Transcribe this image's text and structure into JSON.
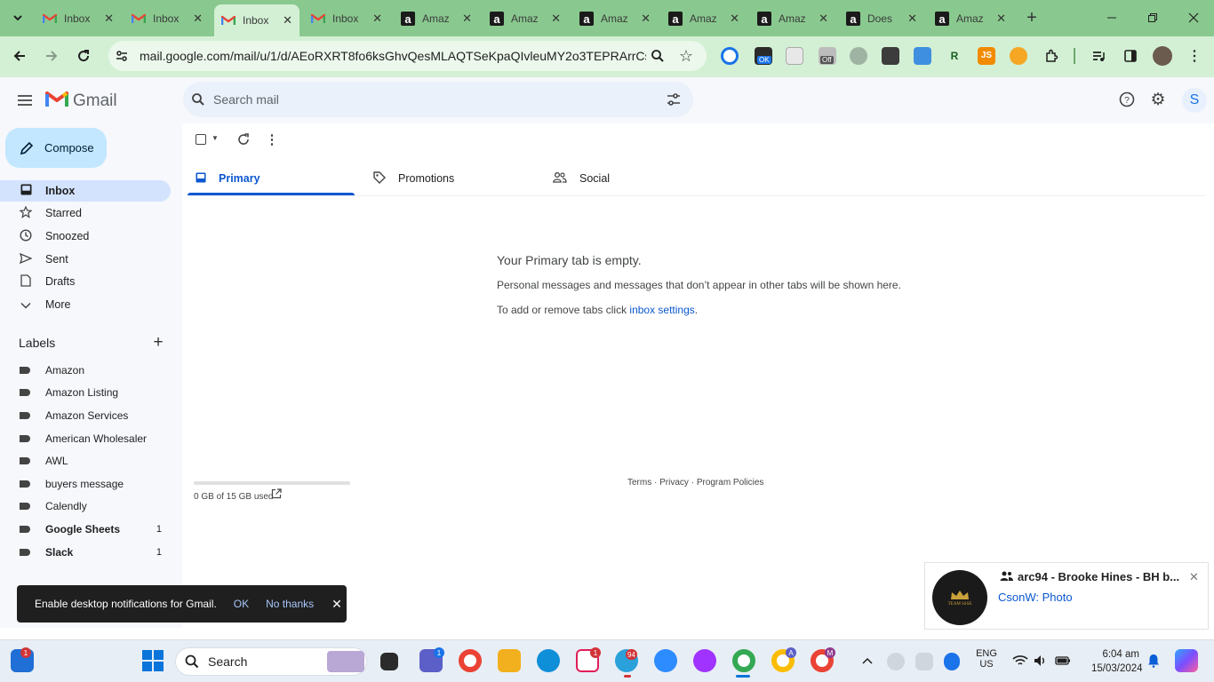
{
  "browser": {
    "tabs": [
      {
        "title": "Inbox",
        "favicon": "gmail-icon",
        "active": false
      },
      {
        "title": "Inbox",
        "favicon": "gmail-icon",
        "active": false
      },
      {
        "title": "Inbox",
        "favicon": "gmail-icon",
        "active": true
      },
      {
        "title": "Inbox",
        "favicon": "gmail-icon",
        "active": false
      },
      {
        "title": "Amaz",
        "favicon": "amazon-icon",
        "active": false
      },
      {
        "title": "Amaz",
        "favicon": "amazon-icon",
        "active": false
      },
      {
        "title": "Amaz",
        "favicon": "amazon-icon",
        "active": false
      },
      {
        "title": "Amaz",
        "favicon": "amazon-icon",
        "active": false
      },
      {
        "title": "Amaz",
        "favicon": "amazon-icon",
        "active": false
      },
      {
        "title": "Does",
        "favicon": "amazon-icon",
        "active": false
      },
      {
        "title": "Amaz",
        "favicon": "amazon-icon",
        "active": false
      }
    ],
    "url": "mail.google.com/mail/u/1/d/AEoRXRT8fo6ksGhvQesMLAQTSeKpaQIvleuMY2o3TEPRArrCs...",
    "theme_color": "#89c98f",
    "toolbar_color": "#d3f0d4"
  },
  "gmail": {
    "logo_text": "Gmail",
    "search_placeholder": "Search mail",
    "avatar_letter": "S",
    "compose_label": "Compose",
    "nav": [
      {
        "label": "Inbox",
        "icon": "inbox-icon",
        "active": true
      },
      {
        "label": "Starred",
        "icon": "star-icon",
        "active": false
      },
      {
        "label": "Snoozed",
        "icon": "clock-icon",
        "active": false
      },
      {
        "label": "Sent",
        "icon": "send-icon",
        "active": false
      },
      {
        "label": "Drafts",
        "icon": "draft-icon",
        "active": false
      },
      {
        "label": "More",
        "icon": "chevron-down-icon",
        "active": false
      }
    ],
    "labels_heading": "Labels",
    "labels": [
      {
        "name": "Amazon",
        "count": "",
        "bold": false
      },
      {
        "name": "Amazon Listing",
        "count": "",
        "bold": false
      },
      {
        "name": "Amazon Services",
        "count": "",
        "bold": false
      },
      {
        "name": "American Wholesaler",
        "count": "",
        "bold": false
      },
      {
        "name": "AWL",
        "count": "",
        "bold": false
      },
      {
        "name": "buyers message",
        "count": "",
        "bold": false
      },
      {
        "name": "Calendly",
        "count": "",
        "bold": false
      },
      {
        "name": "Google Sheets",
        "count": "1",
        "bold": true
      },
      {
        "name": "Slack",
        "count": "1",
        "bold": true
      }
    ],
    "tabs": [
      {
        "label": "Primary",
        "icon": "inbox-icon",
        "active": true
      },
      {
        "label": "Promotions",
        "icon": "tag-icon",
        "active": false
      },
      {
        "label": "Social",
        "icon": "people-icon",
        "active": false
      }
    ],
    "empty": {
      "title": "Your Primary tab is empty.",
      "line1": "Personal messages and messages that don’t appear in other tabs will be shown here.",
      "line2_prefix": "To add or remove tabs click ",
      "line2_link": "inbox settings",
      "line2_suffix": "."
    },
    "storage": {
      "text": "0 GB of 15 GB used",
      "fraction": 0.0
    },
    "footer": {
      "terms": "Terms",
      "privacy": "Privacy",
      "policies": "Program Policies",
      "sep": " · "
    },
    "snackbar": {
      "message": "Enable desktop notifications for Gmail.",
      "ok": "OK",
      "no_thanks": "No thanks"
    }
  },
  "notification": {
    "title": "arc94 - Brooke Hines - BH b...",
    "body": "CsonW: Photo",
    "logo_text": "TEAM SSSE"
  },
  "taskbar": {
    "search_label": "Search",
    "lang_top": "ENG",
    "lang_bottom": "US",
    "time": "6:04 am",
    "date": "15/03/2024",
    "badges": {
      "widgets": "1",
      "teams": "1",
      "slack": "1",
      "telegram": "94",
      "chrome_a": "A",
      "chrome_m": "M"
    }
  }
}
